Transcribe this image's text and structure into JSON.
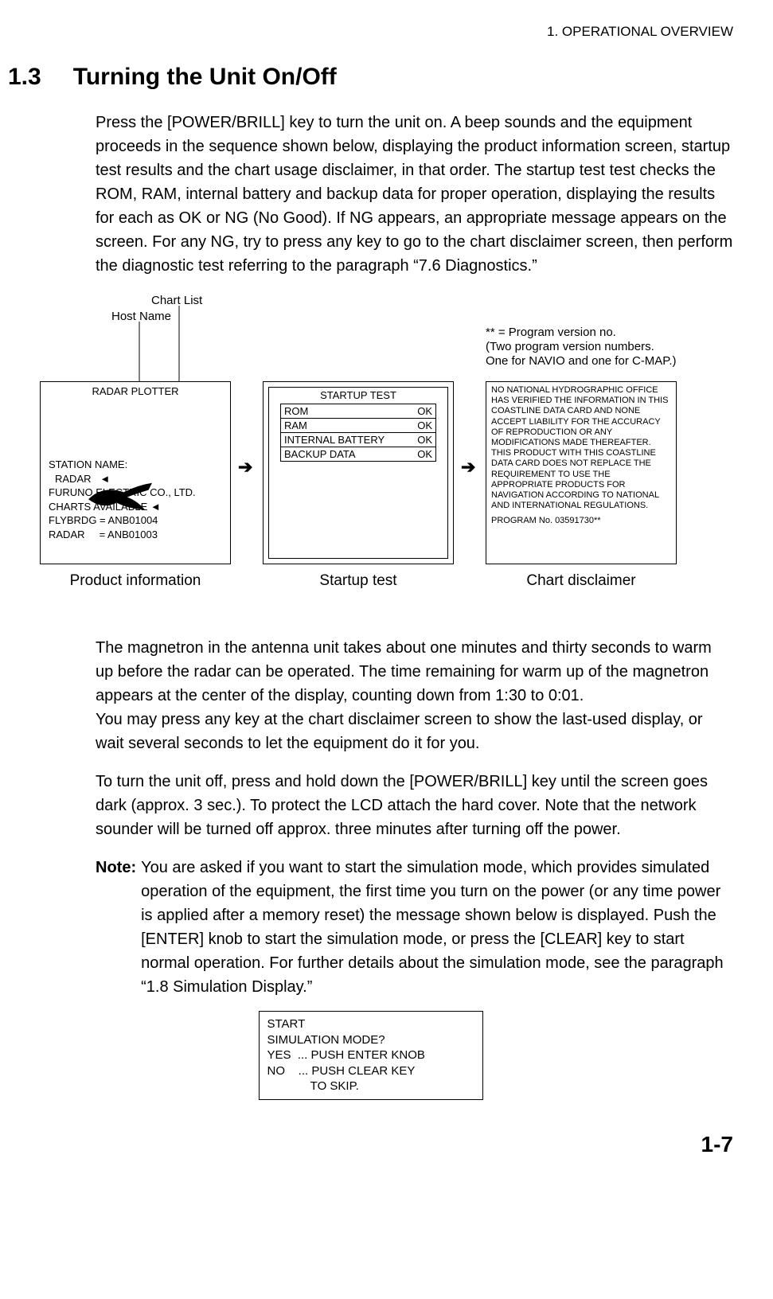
{
  "header": {
    "chapter": "1. OPERATIONAL OVERVIEW"
  },
  "section": {
    "num": "1.3",
    "title": "Turning the Unit On/Off"
  },
  "para1": "Press the [POWER/BRILL] key to turn the unit on. A beep sounds and the equipment proceeds in the sequence shown below, displaying the product information screen, startup test results and the chart usage disclaimer, in that order. The startup test test checks the ROM, RAM, internal battery and backup data for proper operation, displaying the results for each as OK or NG (No Good). If NG appears, an appropriate message appears on the screen. For any NG, try to press any key to go to the chart disclaimer screen, then perform the diagnostic test referring to the paragraph “7.6 Diagnostics.”",
  "anno": {
    "chart_list": "Chart List",
    "host_name": "Host Name",
    "ver_note1": "** = Program version no.",
    "ver_note2": "(Two program version numbers.",
    "ver_note3": "One for NAVIO and one for C-MAP.)"
  },
  "box1": {
    "title": "RADAR PLOTTER",
    "station_label": "STATION NAME:",
    "station_value": "RADAR",
    "company": "FURUNO ELECTRIC CO., LTD.",
    "charts_avail": "CHARTS AVAILABLE",
    "line_a": "FLYBRDG = ANB01004",
    "line_b": "RADAR     = ANB01003"
  },
  "box2": {
    "title": "STARTUP TEST",
    "rows": [
      {
        "name": "ROM",
        "status": "OK"
      },
      {
        "name": "RAM",
        "status": "OK"
      },
      {
        "name": "INTERNAL BATTERY",
        "status": "OK"
      },
      {
        "name": "BACKUP DATA",
        "status": "OK"
      }
    ]
  },
  "box3": {
    "disclaimer": "NO NATIONAL HYDROGRAPHIC OFFICE HAS VERIFIED THE INFORMATION IN THIS COASTLINE DATA CARD AND NONE ACCEPT LIABILITY FOR THE ACCURACY OF REPRODUCTION OR ANY MODIFICATIONS MADE THEREAFTER. THIS PRODUCT WITH THIS COASTLINE DATA CARD DOES NOT REPLACE THE REQUIREMENT TO USE THE APPROPRIATE PRODUCTS FOR NAVIGATION ACCORDING TO NATIONAL AND INTERNATIONAL REGULATIONS.",
    "program_no": "PROGRAM No. 03591730**"
  },
  "captions": {
    "c1": "Product information",
    "c2": "Startup test",
    "c3": "Chart disclaimer"
  },
  "para2": "The magnetron in the antenna unit takes about one minutes and thirty seconds to warm up before the radar can be operated. The time remaining for warm up of the magnetron appears at the center of the display, counting down from 1:30 to 0:01.",
  "para3": "You may press any key at the chart disclaimer screen to show the last-used display, or wait several seconds to let the equipment do it for you.",
  "para4": "To turn the unit off, press and hold down the [POWER/BRILL] key until the screen goes dark (approx. 3 sec.). To protect the LCD attach the hard cover. Note that the network sounder will be turned off approx. three minutes after turning off the power.",
  "note": {
    "label": "Note:",
    "body": "You are asked if you want to start the simulation mode, which provides simulated operation of the equipment, the first time you turn on the power (or any time power is applied after a memory reset) the message shown below is displayed. Push the [ENTER] knob to start the simulation mode, or press the [CLEAR] key to start normal operation. For further details about the simulation mode, see the paragraph “1.8 Simulation Display.”"
  },
  "sim_box": {
    "l1": "START",
    "l2": "SIMULATION MODE?",
    "l3": "YES  ... PUSH ENTER KNOB",
    "l4": "NO    ... PUSH CLEAR KEY",
    "l5": "             TO SKIP."
  },
  "page_num": "1-7"
}
